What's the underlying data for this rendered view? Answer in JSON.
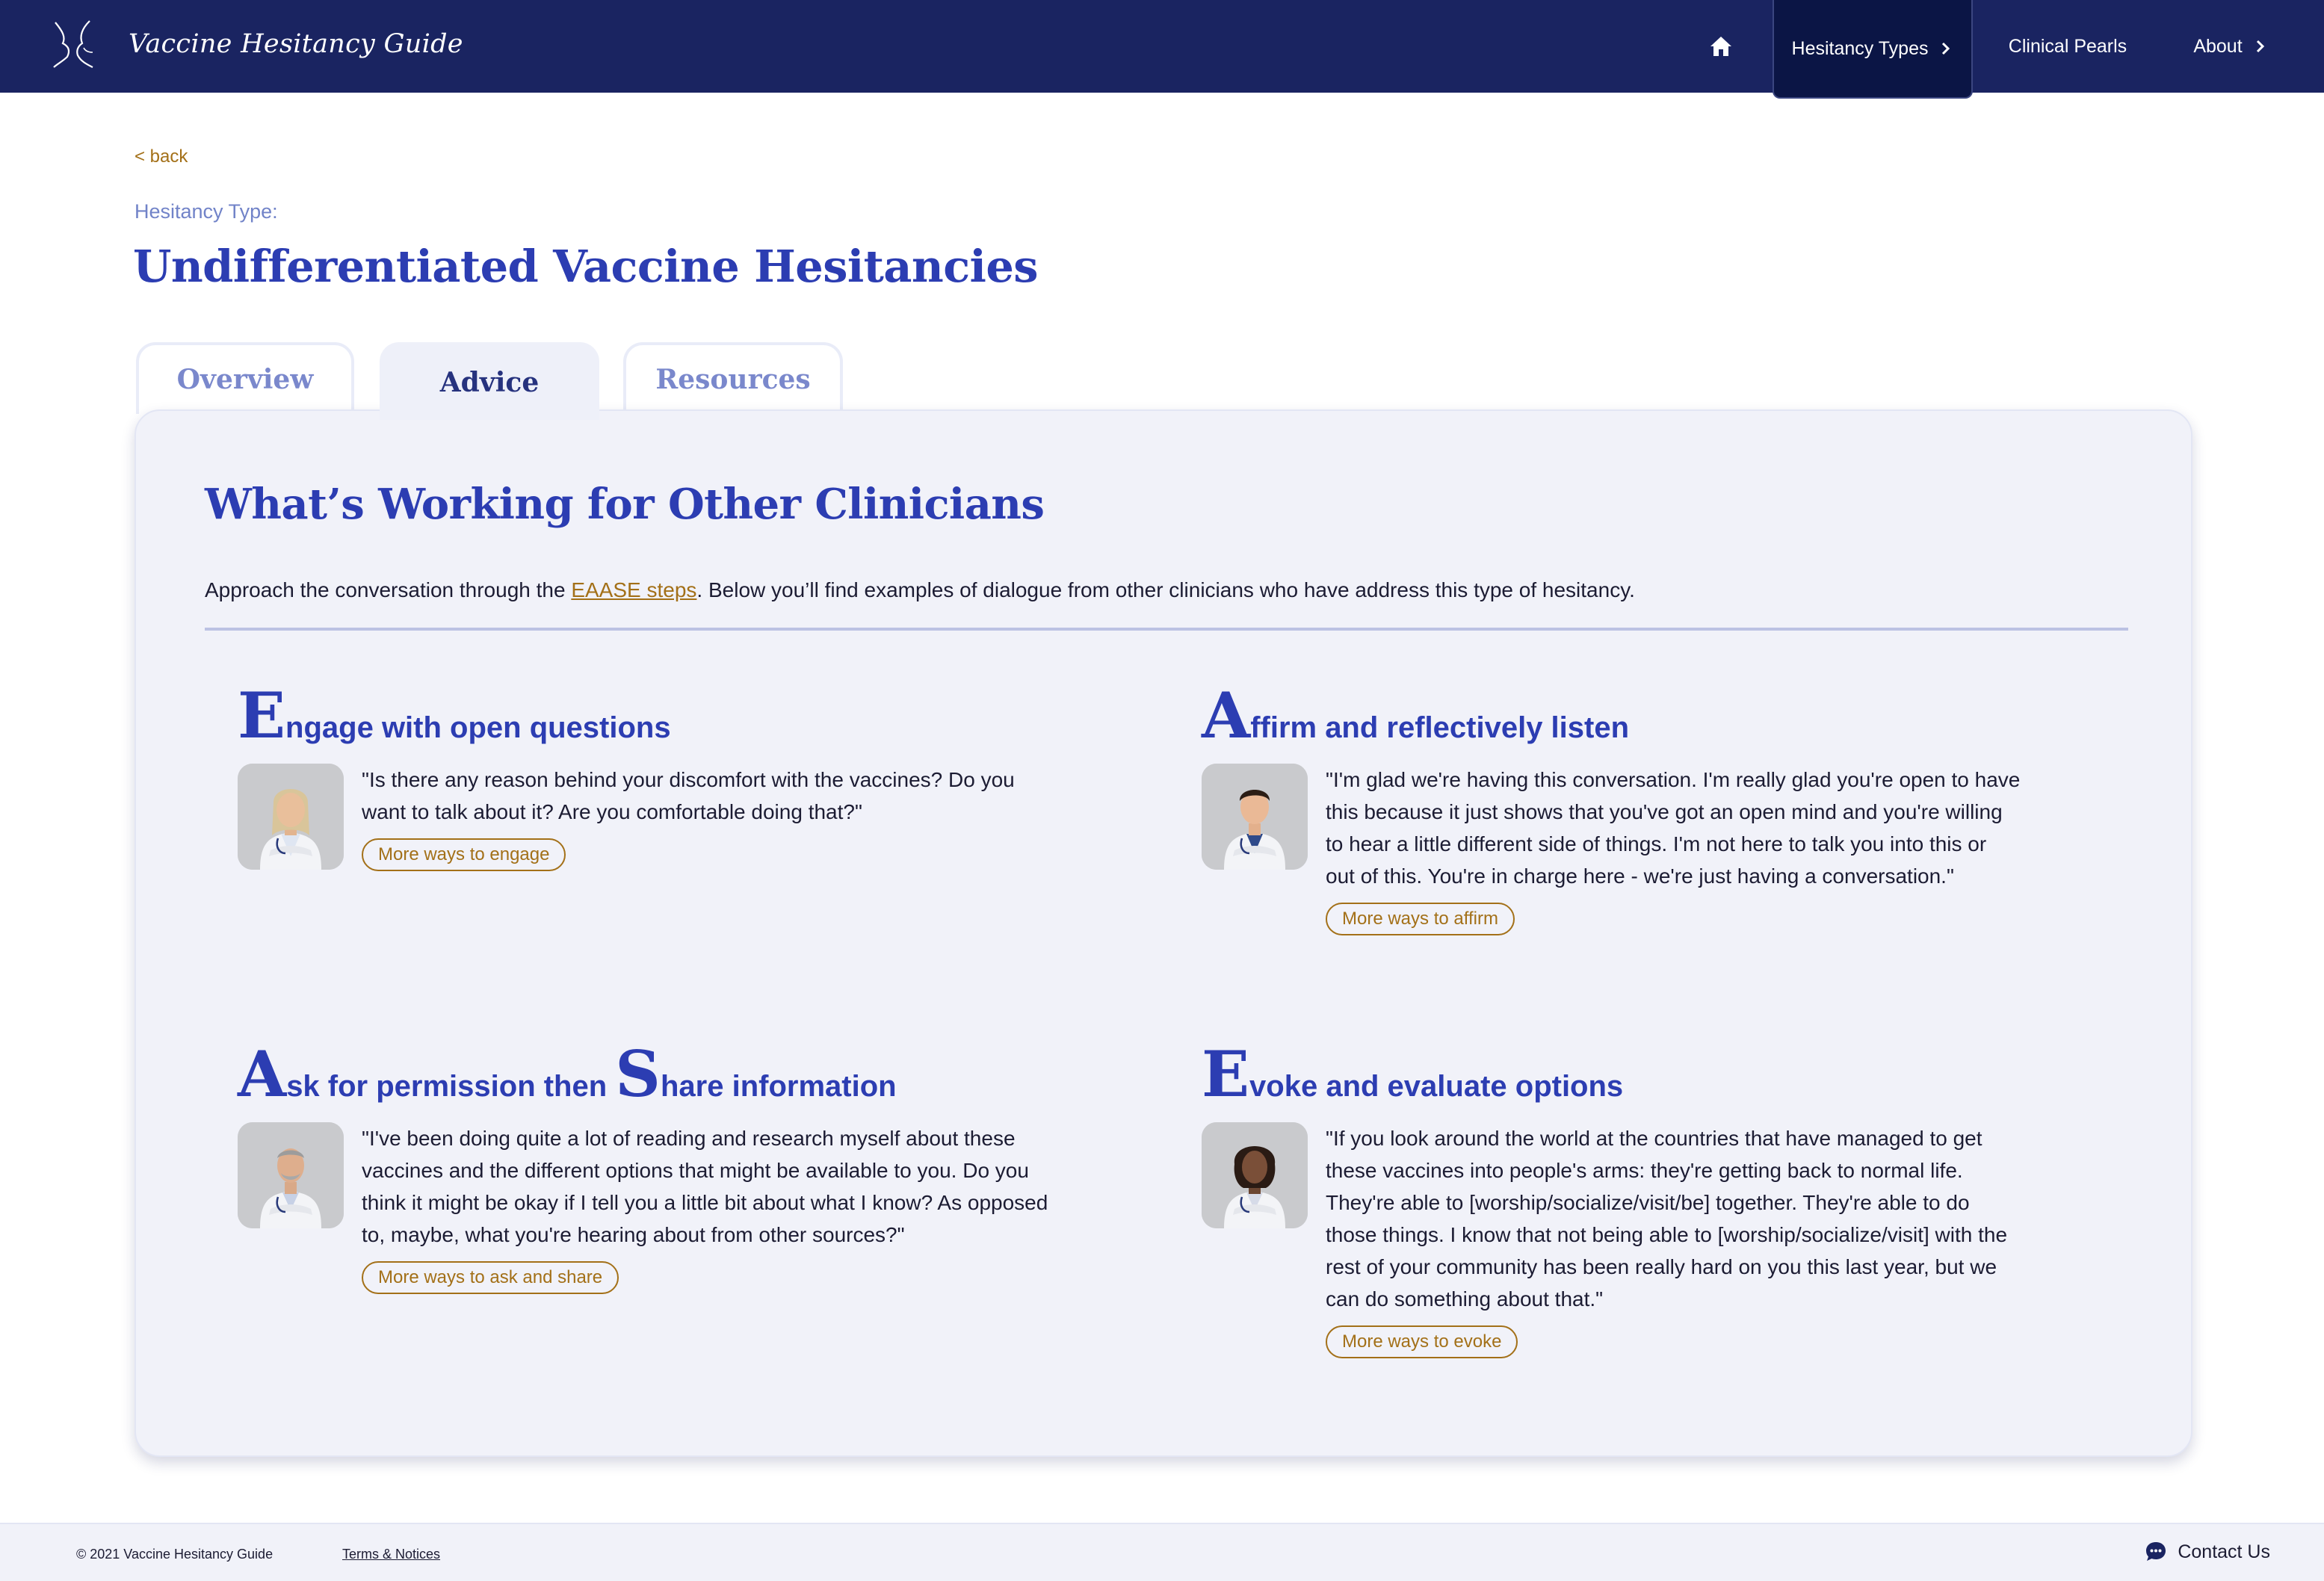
{
  "header": {
    "brand": "Vaccine Hesitancy Guide",
    "nav": {
      "home_icon": "home-icon",
      "hesitancy_types": "Hesitancy Types",
      "clinical_pearls": "Clinical Pearls",
      "about": "About"
    }
  },
  "intro": {
    "back": "< back",
    "type_label": "Hesitancy Type:",
    "title": "Undifferentiated Vaccine Hesitancies"
  },
  "tabs": [
    {
      "label": "Overview",
      "active": false
    },
    {
      "label": "Advice",
      "active": true
    },
    {
      "label": "Resources",
      "active": false
    }
  ],
  "advice": {
    "heading": "What’s Working for Other Clinicians",
    "intro_before": "Approach the conversation through the ",
    "intro_link": "EAASE steps",
    "intro_after": ". Below you’ll find examples of dialogue from other clinicians who have address this type of hesitancy.",
    "steps": [
      {
        "initial": "E",
        "rest": "ngage with open questions",
        "quote": "\"Is there any reason behind your discomfort with the vaccines? Do you want to talk about it? Are you comfortable doing that?\"",
        "button": "More ways to engage"
      },
      {
        "initial": "A",
        "rest": "ffirm and reflectively listen",
        "quote": "\"I'm glad we're having this conversation. I'm really glad you're open to have this because it just shows that you've got an open mind and you're willing to hear a little different side of things. I'm not here to talk you into this or out of this. You're in charge here - we're just having a conversation.\"",
        "button": "More ways to affirm"
      },
      {
        "initial": "A",
        "rest": "sk for permission then ",
        "initial2": "S",
        "rest2": "hare information",
        "quote": "\"I've been doing quite a lot of reading and research myself about these vaccines and the different options that might be available to you. Do you think it might be okay if I tell you a little bit about what I know? As opposed to, maybe, what you're hearing about from other sources?\"",
        "button": "More ways to ask and share"
      },
      {
        "initial": "E",
        "rest": "voke and evaluate options",
        "quote": "\"If you look around the world at the countries that have managed to get these vaccines into people's arms: they're getting back to normal life. They're able to [worship/socialize/visit/be] together. They're able to do those things. I know that not being able to [worship/socialize/visit] with the rest of your community has been really hard on you this last year, but we can do something about that.\"",
        "button": "More ways to evoke"
      }
    ]
  },
  "footer": {
    "copyright": "© 2021 Vaccine Hesitancy Guide",
    "terms": "Terms & Notices",
    "contact": "Contact Us"
  },
  "colors": {
    "navy": "#1a2461",
    "title_blue": "#2c3db2",
    "gold": "#a37018",
    "card_bg": "#f1f2f9"
  }
}
